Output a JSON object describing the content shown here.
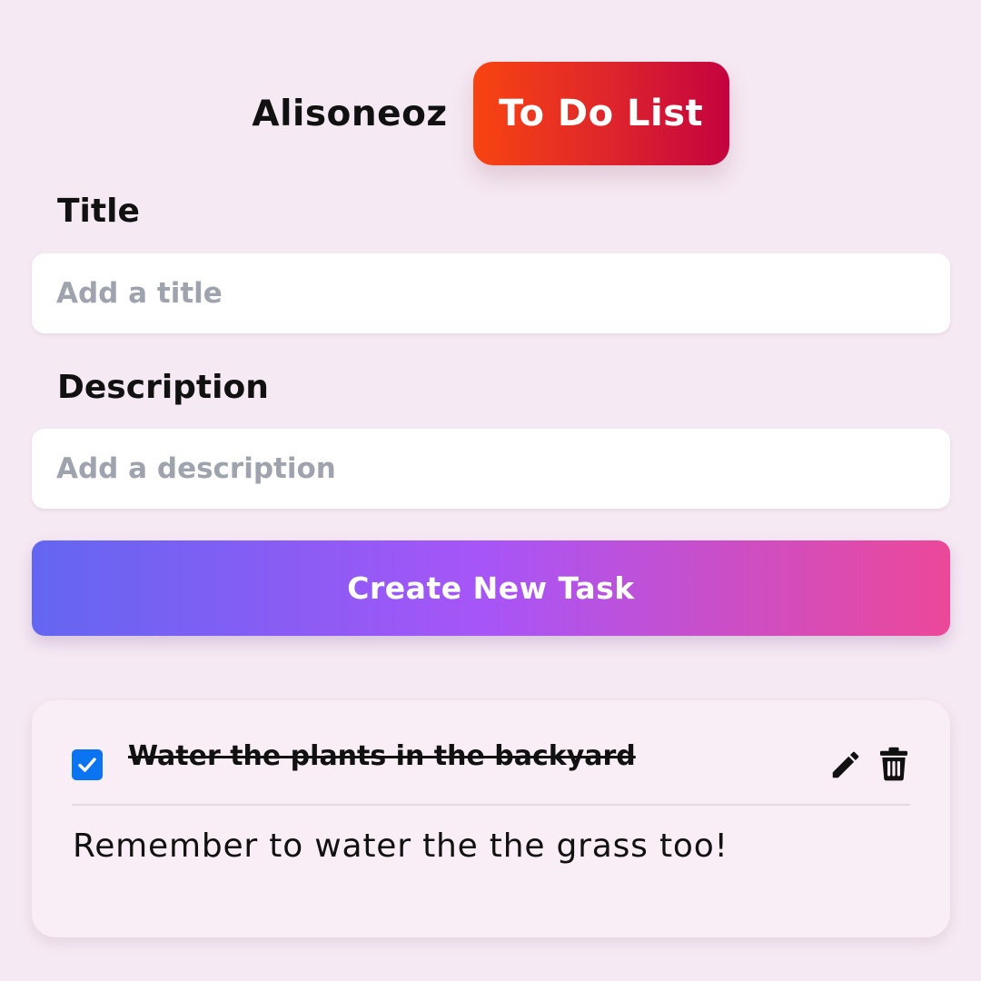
{
  "header": {
    "brand": "Alisoneoz",
    "app_title": "To Do List"
  },
  "form": {
    "title_label": "Title",
    "title_placeholder": "Add a title",
    "title_value": "",
    "description_label": "Description",
    "description_placeholder": "Add a description",
    "description_value": "",
    "create_button_label": "Create New Task"
  },
  "tasks": [
    {
      "title": "Water the plants in the backyard",
      "description": "Remember to water the the grass too!",
      "completed": true,
      "edit_icon": "pencil-icon",
      "delete_icon": "trash-icon"
    }
  ],
  "colors": {
    "background": "#f5e9f3",
    "badge_gradient": [
      "#f84411",
      "#c4033f"
    ],
    "button_gradient": [
      "#6366f1",
      "#a855f7",
      "#ec4899"
    ],
    "checkbox": "#0b74f0",
    "placeholder": "#9ea3ad"
  }
}
